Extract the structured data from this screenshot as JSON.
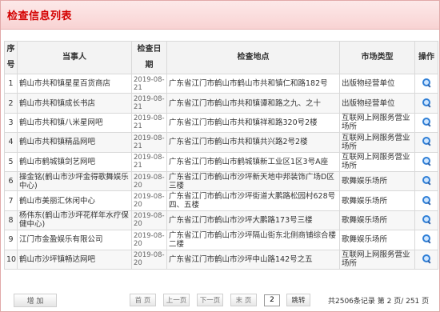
{
  "panel": {
    "title": "检查信息列表"
  },
  "table": {
    "headers": {
      "idx": "序号",
      "party": "当事人",
      "date": "检查日期",
      "location": "检查地点",
      "market_type": "市场类型",
      "op": "操作"
    },
    "rows": [
      {
        "idx": "1",
        "party": "鹤山市共和镇星星百货商店",
        "date": "2019-08-21",
        "location": "广东省江门市鹤山市鹤山市共和镇仁和路182号",
        "market_type": "出版物经营单位"
      },
      {
        "idx": "2",
        "party": "鹤山市共和镇成长书店",
        "date": "2019-08-21",
        "location": "广东省江门市鹤山市共和镇谭和路之九、之十",
        "market_type": "出版物经营单位"
      },
      {
        "idx": "3",
        "party": "鹤山市共和镇八米星网吧",
        "date": "2019-08-21",
        "location": "广东省江门市鹤山市共和镇祥和路320号2楼",
        "market_type": "互联网上网服务营业场所"
      },
      {
        "idx": "4",
        "party": "鹤山市共和镇精品网吧",
        "date": "2019-08-21",
        "location": "广东省江门市鹤山市共和镇共兴路2号2楼",
        "market_type": "互联网上网服务营业场所"
      },
      {
        "idx": "5",
        "party": "鹤山市鹤城镇剑艺网吧",
        "date": "2019-08-21",
        "location": "广东省江门市鹤山市鹤城镇新工业区1区3号A座",
        "market_type": "互联网上网服务营业场所"
      },
      {
        "idx": "6",
        "party": "操金铭(鹤山市沙坪金得歌舞娱乐中心)",
        "date": "2019-08-20",
        "location": "广东省江门市鹤山市沙坪新天地中邦装饰广场D区三楼",
        "market_type": "歌舞娱乐场所"
      },
      {
        "idx": "7",
        "party": "鹤山市美丽汇休闲中心",
        "date": "2019-08-20",
        "location": "广东省江门市鹤山市沙坪街道大鹏路松园村628号四、五楼",
        "market_type": "歌舞娱乐场所"
      },
      {
        "idx": "8",
        "party": "杨伟东(鹤山市沙坪花样年水疗保健中心)",
        "date": "2019-08-20",
        "location": "广东省江门市鹤山市沙坪大鹏路173号三楼",
        "market_type": "歌舞娱乐场所"
      },
      {
        "idx": "9",
        "party": "江门市金盈娱乐有限公司",
        "date": "2019-08-20",
        "location": "广东省江门市鹤山市沙坪隔山街东北侧商铺综合楼二楼",
        "market_type": "歌舞娱乐场所"
      },
      {
        "idx": "10",
        "party": "鹤山市沙坪镇畅达网吧",
        "date": "2019-08-20",
        "location": "广东省江门市鹤山市沙坪中山路142号之五",
        "market_type": "互联网上网服务营业场所"
      }
    ]
  },
  "footer": {
    "add_label": "增 加",
    "first_label": "首 页",
    "prev_label": "上一页",
    "next_label": "下一页",
    "last_label": "末 页",
    "page_value": "2",
    "go_label": "跳转",
    "summary": "共2506条记录 第 2 页/ 251 页"
  },
  "icons": {
    "row_action": "search-icon"
  },
  "colors": {
    "title": "#d40000",
    "header_bg": "#f8d3d3",
    "icon": "#2f7fd6"
  }
}
